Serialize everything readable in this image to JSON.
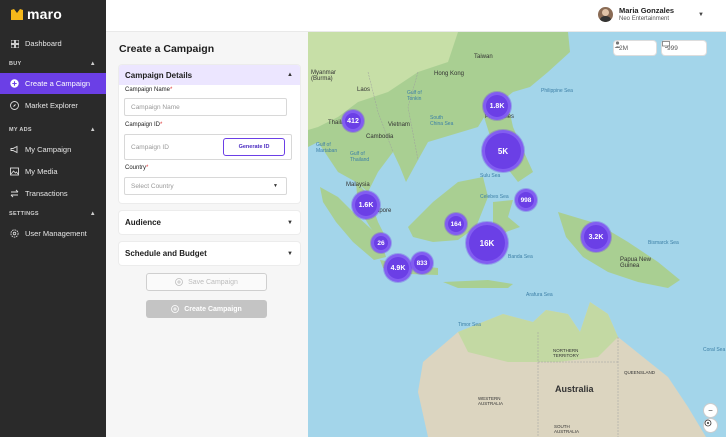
{
  "brand": {
    "name": "maro"
  },
  "sidebar": {
    "dashboard": "Dashboard",
    "sections": {
      "buy": "BUY",
      "my_ads": "MY ADS",
      "settings": "SETTINGS"
    },
    "buy_items": [
      "Create a Campaign",
      "Market Explorer"
    ],
    "my_ads_items": [
      "My Campaign",
      "My Media",
      "Transactions"
    ],
    "settings_items": [
      "User Management"
    ]
  },
  "header": {
    "user_name": "Maria Gonzales",
    "user_org": "Neo Entertainment"
  },
  "form": {
    "title": "Create a Campaign",
    "details_title": "Campaign Details",
    "name_label": "Campaign Name",
    "name_placeholder": "Campaign Name",
    "id_label": "Campaign ID",
    "id_placeholder": "Campaign ID",
    "generate_label": "Generate ID",
    "country_label": "Country",
    "country_placeholder": "Select Country",
    "required_mark": "*",
    "audience_title": "Audience",
    "schedule_title": "Schedule and Budget",
    "save_label": "Save Campaign",
    "create_label": "Create Campaign"
  },
  "map": {
    "stats": {
      "audience": "2M",
      "screens": "999"
    },
    "clusters": [
      "412",
      "1.8K",
      "5K",
      "1.6K",
      "998",
      "164",
      "16K",
      "26",
      "3.2K",
      "4.9K",
      "833"
    ],
    "places": {
      "myanmar": "Myanmar\n(Burma)",
      "laos": "Laos",
      "thailand": "Thailand",
      "cambodia": "Cambodia",
      "vietnam": "Vietnam",
      "malaysia": "Malaysia",
      "singapore": "apore",
      "hong_kong": "Hong Kong",
      "taiwan": "Taiwan",
      "philippines": "Philippines",
      "papua": "Papua New\nGuinea",
      "australia": "Australia",
      "northern_territory": "NORTHERN\nTERRITORY",
      "western_australia": "WESTERN\nAUSTRALIA",
      "queensland": "QUEENSLAND",
      "south_australia": "SOUTH\nAUSTRALIA"
    },
    "seas": {
      "philippine_sea": "Philippine Sea",
      "south_china_sea": "South\nChina Sea",
      "gulf_thailand": "Gulf of\nThailand",
      "gulf_martaban": "Gulf of\nMartaban",
      "celebes_sea": "Celebes Sea",
      "banda_sea": "Banda Sea",
      "bismarck_sea": "Bismarck Sea",
      "sulu_sea": "Sulu Sea",
      "arafura_sea": "Arafura Sea",
      "timor_sea": "Timor Sea",
      "coral_sea": "Coral Sea",
      "gulf_tonkin": "Gulf of\nTonkin"
    }
  }
}
